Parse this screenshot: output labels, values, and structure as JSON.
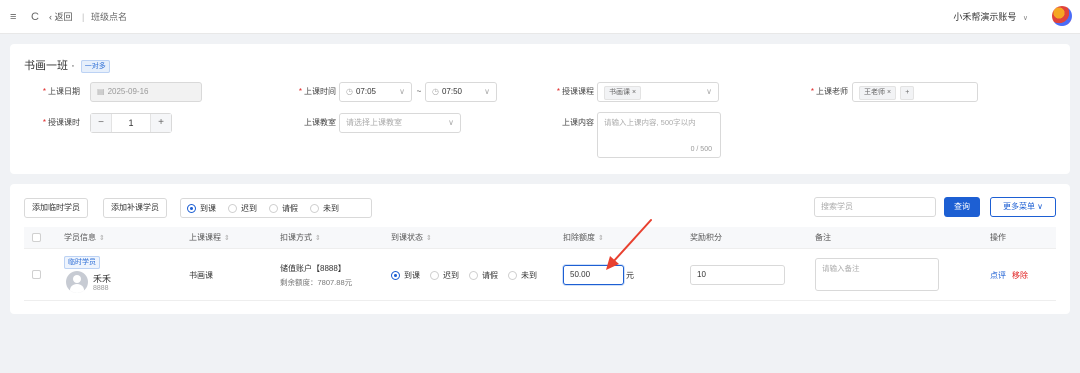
{
  "topbar": {
    "menu_icon": "≡",
    "refresh_icon": "C",
    "back_label": "‹ 返回",
    "separator": "|",
    "page_title": "班级点名",
    "account_label": "小禾帮演示账号",
    "account_chevron": "∨"
  },
  "lesson": {
    "class_name": "书画一班",
    "class_dot": "·",
    "class_type": "一对多",
    "date_label": "上课日期",
    "date_value": "2025-09-16",
    "time_label": "上课时间",
    "time_start": "07:05",
    "time_sep": "~",
    "time_end": "07:50",
    "course_label": "授课课程",
    "course_chip": "书画课 ×",
    "teacher_label": "上课老师",
    "teacher_chip": "王老师 ×",
    "teacher_add": "+",
    "hours_label": "授课课时",
    "hours_minus": "−",
    "hours_value": "1",
    "hours_plus": "+",
    "room_label": "上课教室",
    "room_placeholder": "请选择上课教室",
    "content_label": "上课内容",
    "content_placeholder": "请输入上课内容, 500字以内",
    "content_counter": "0 / 500"
  },
  "toolbar": {
    "add_temp": "添加临时学员",
    "add_makeup": "添加补课学员",
    "status_options": [
      "到课",
      "迟到",
      "请假",
      "未到"
    ],
    "status_selected": 0,
    "search_placeholder": "搜索学员",
    "query_button": "查询",
    "more_menu": "更多菜单 ∨"
  },
  "table": {
    "headers": {
      "student": "学员信息",
      "course": "上课课程",
      "deduct_method": "扣课方式",
      "attendance": "到课状态",
      "deduct_amount": "扣除额度",
      "points": "奖励积分",
      "remark": "备注",
      "actions": "操作"
    },
    "sort_icon": "⇕",
    "rows": [
      {
        "tag": "临时学员",
        "name": "禾禾",
        "id": "8888",
        "course": "书画课",
        "account": "储值账户【8888】",
        "balance": "剩余额度：7807.88元",
        "attendance_options": [
          "到课",
          "迟到",
          "请假",
          "未到"
        ],
        "attendance_selected": 0,
        "deduct_value": "50.00",
        "deduct_unit": "元",
        "points_value": "10",
        "remark_placeholder": "请输入备注",
        "action_comment": "点评",
        "action_remove": "移除"
      }
    ]
  },
  "colors": {
    "primary": "#1d5fd3",
    "danger": "#e02020",
    "arrow": "#e8402f"
  }
}
